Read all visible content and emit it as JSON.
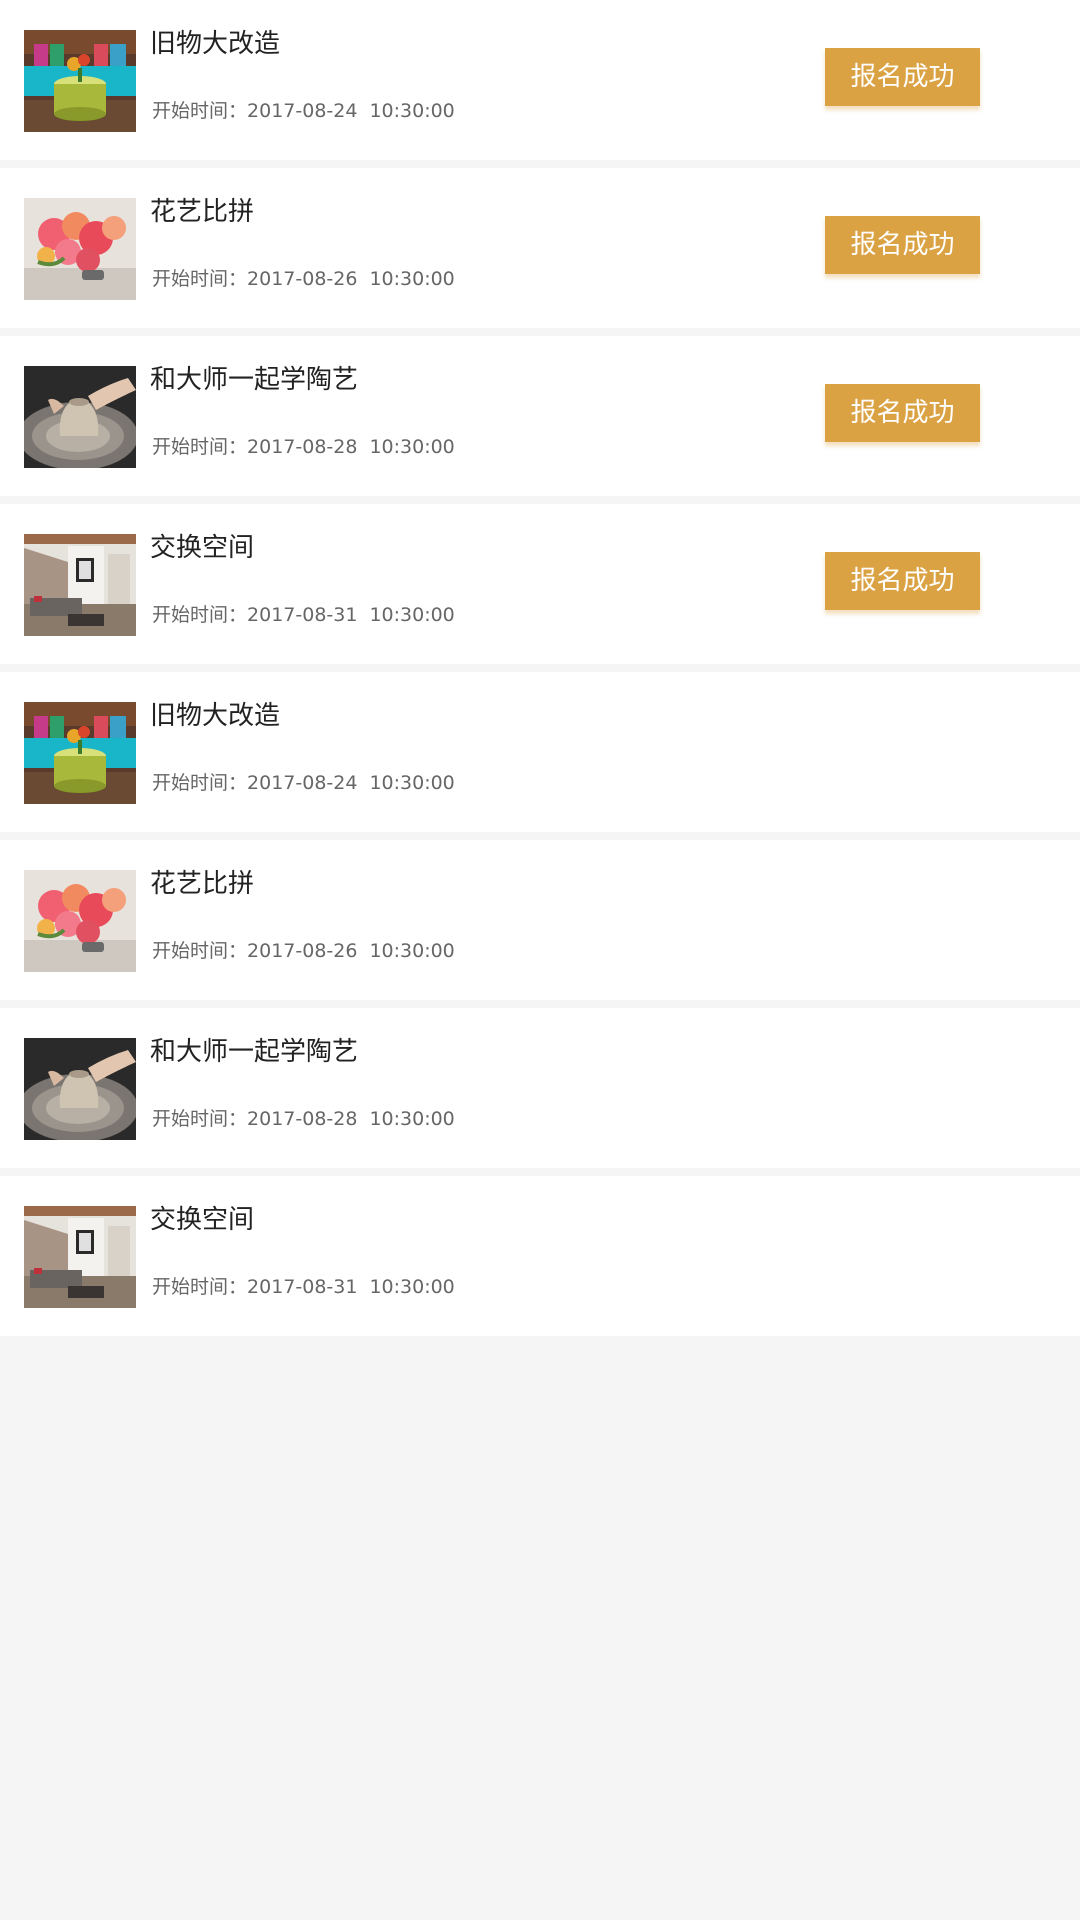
{
  "accent_color": "#dba243",
  "activities": [
    {
      "title": "旧物大改造",
      "time_label": "开始时间：",
      "date": "2017-08-24",
      "clock": "10:30:00",
      "status": "报名成功",
      "thumb": "living-room",
      "thumb_icon": "living-room-image"
    },
    {
      "title": "花艺比拼",
      "time_label": "开始时间：",
      "date": "2017-08-26",
      "clock": "10:30:00",
      "status": "报名成功",
      "thumb": "flowers",
      "thumb_icon": "flower-bouquet-image"
    },
    {
      "title": "和大师一起学陶艺",
      "time_label": "开始时间：",
      "date": "2017-08-28",
      "clock": "10:30:00",
      "status": "报名成功",
      "thumb": "pottery",
      "thumb_icon": "pottery-wheel-image"
    },
    {
      "title": "交换空间",
      "time_label": "开始时间：",
      "date": "2017-08-31",
      "clock": "10:30:00",
      "status": "报名成功",
      "thumb": "interior",
      "thumb_icon": "interior-room-image"
    },
    {
      "title": "旧物大改造",
      "time_label": "开始时间：",
      "date": "2017-08-24",
      "clock": "10:30:00",
      "status": "",
      "thumb": "living-room",
      "thumb_icon": "living-room-image"
    },
    {
      "title": "花艺比拼",
      "time_label": "开始时间：",
      "date": "2017-08-26",
      "clock": "10:30:00",
      "status": "",
      "thumb": "flowers",
      "thumb_icon": "flower-bouquet-image"
    },
    {
      "title": "和大师一起学陶艺",
      "time_label": "开始时间：",
      "date": "2017-08-28",
      "clock": "10:30:00",
      "status": "",
      "thumb": "pottery",
      "thumb_icon": "pottery-wheel-image"
    },
    {
      "title": "交换空间",
      "time_label": "开始时间：",
      "date": "2017-08-31",
      "clock": "10:30:00",
      "status": "",
      "thumb": "interior",
      "thumb_icon": "interior-room-image"
    }
  ]
}
